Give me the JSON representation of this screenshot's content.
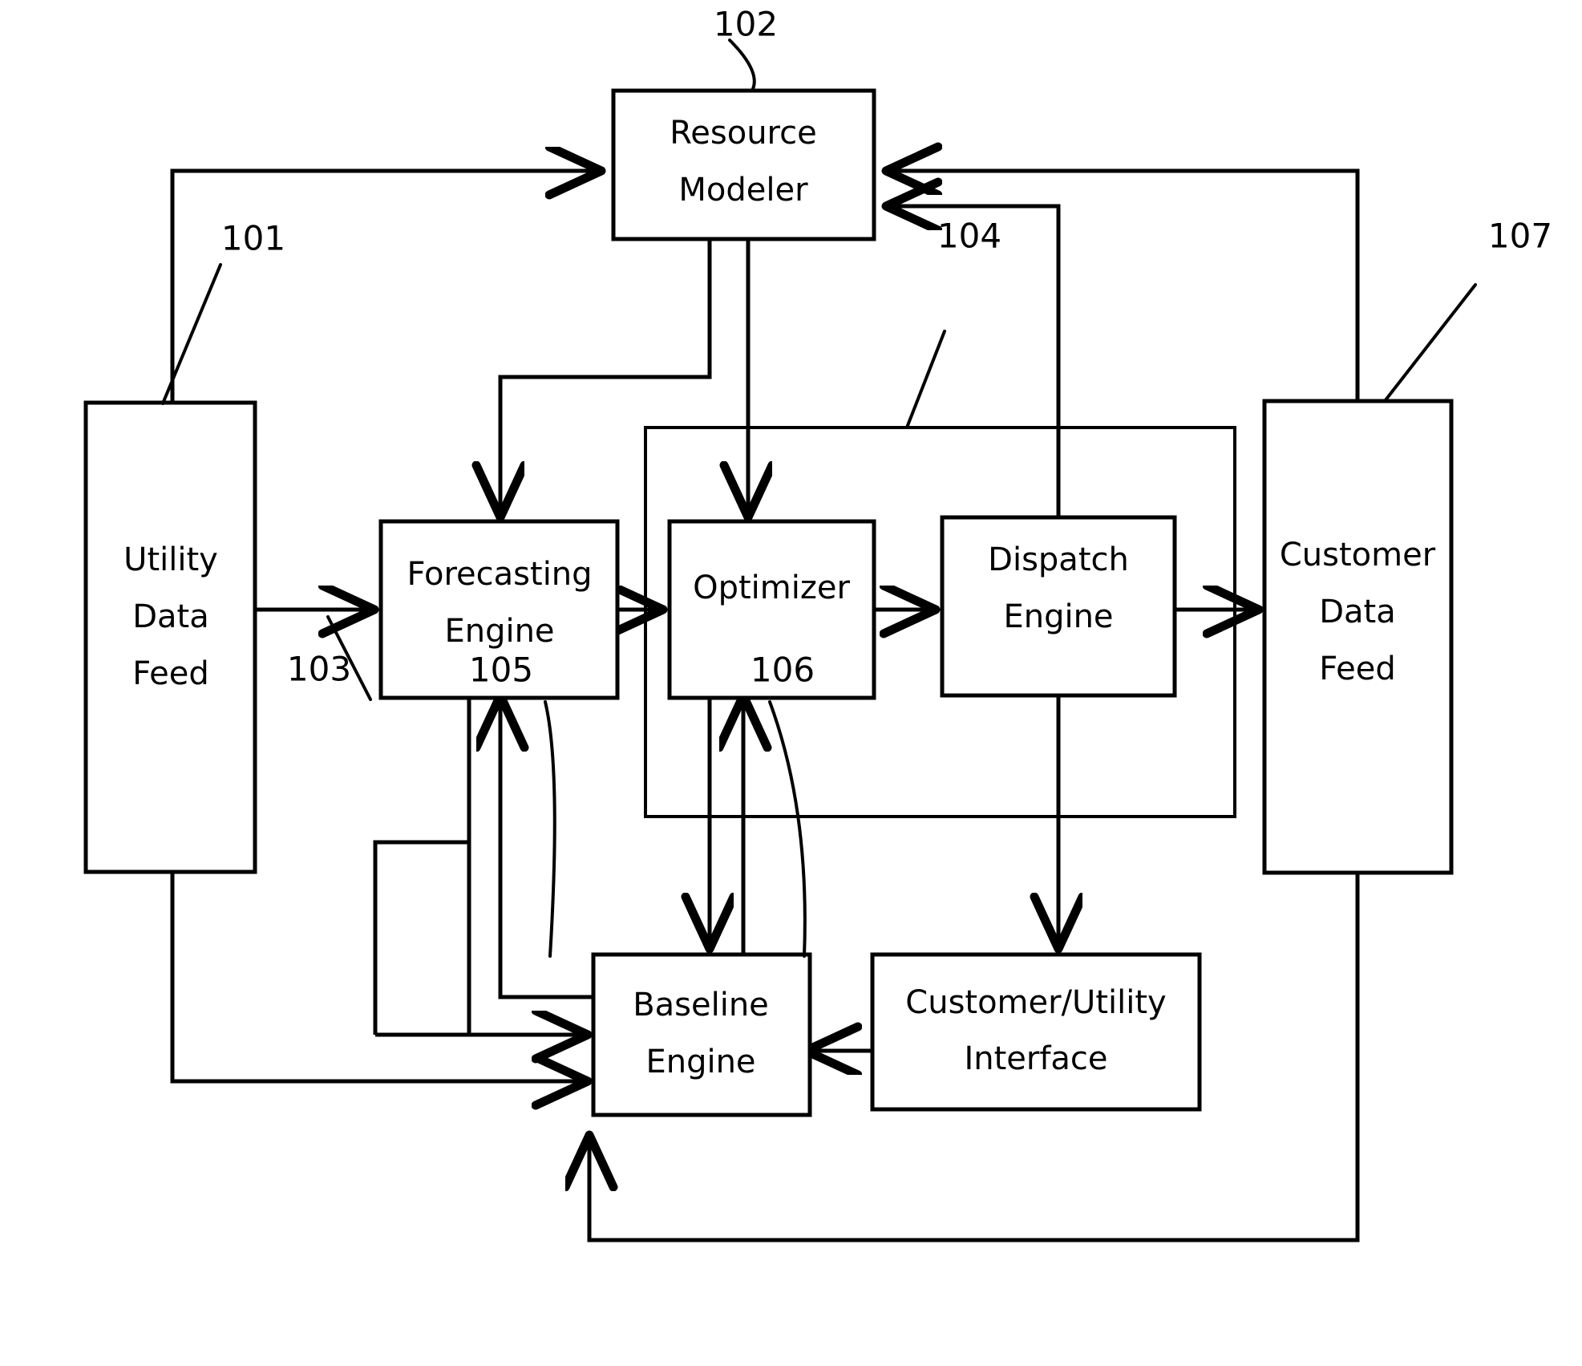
{
  "figure": {
    "type": "patent-block-diagram",
    "background_color": "#ffffff",
    "line_color": "#000000",
    "blocks": [
      {
        "id": "resource_modeler",
        "ref": "102",
        "line1": "Resource",
        "line2": "Modeler"
      },
      {
        "id": "utility_data_feed",
        "ref": "101",
        "line1": "Utility",
        "line2": "Data",
        "line3": "Feed"
      },
      {
        "id": "forecasting_engine",
        "ref": "103",
        "line1": "Forecasting",
        "line2": "Engine"
      },
      {
        "id": "optimizer",
        "ref": "",
        "line1": "Optimizer"
      },
      {
        "id": "dispatch_engine",
        "ref": "",
        "line1": "Dispatch",
        "line2": "Engine"
      },
      {
        "id": "customer_data_feed",
        "ref": "107",
        "line1": "Customer",
        "line2": "Data",
        "line3": "Feed"
      },
      {
        "id": "baseline_engine",
        "ref": "105",
        "line1": "Baseline",
        "line2": "Engine"
      },
      {
        "id": "customer_utility_interface",
        "ref": "106",
        "line1": "Customer/Utility",
        "line2": "Interface"
      },
      {
        "id": "system_container",
        "ref": "104",
        "line1": ""
      }
    ],
    "reference_numerals": {
      "n101": "101",
      "n102": "102",
      "n103": "103",
      "n104": "104",
      "n105": "105",
      "n106": "106",
      "n107": "107"
    },
    "labels": {
      "resource_modeler_l1": "Resource",
      "resource_modeler_l2": "Modeler",
      "utility_data_feed_l1": "Utility",
      "utility_data_feed_l2": "Data",
      "utility_data_feed_l3": "Feed",
      "forecasting_engine_l1": "Forecasting",
      "forecasting_engine_l2": "Engine",
      "optimizer_l1": "Optimizer",
      "dispatch_engine_l1": "Dispatch",
      "dispatch_engine_l2": "Engine",
      "customer_data_feed_l1": "Customer",
      "customer_data_feed_l2": "Data",
      "customer_data_feed_l3": "Feed",
      "baseline_engine_l1": "Baseline",
      "baseline_engine_l2": "Engine",
      "customer_utility_interface_l1": "Customer/Utility",
      "customer_utility_interface_l2": "Interface"
    }
  }
}
